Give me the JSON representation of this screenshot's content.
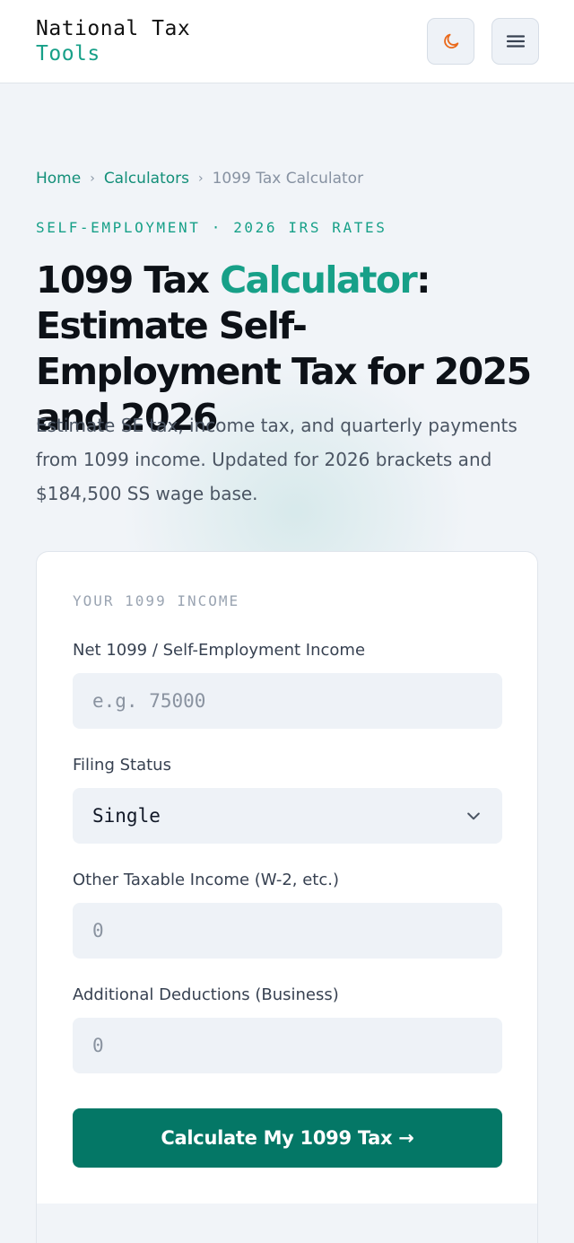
{
  "header": {
    "logo_line1": "National Tax",
    "logo_line2": "Tools",
    "theme_toggle_icon": "moon-icon",
    "menu_icon": "hamburger-menu-icon"
  },
  "breadcrumb": {
    "items": [
      "Home",
      "Calculators"
    ],
    "current": "1099 Tax Calculator",
    "separator": "›"
  },
  "hero": {
    "eyebrow": "SELF-EMPLOYMENT · 2026 IRS RATES",
    "title_part1": "1099 Tax ",
    "title_accent": "Calculator",
    "title_part2": ": Estimate Self-Employment Tax for 2025 and 2026",
    "subtitle": "Estimate SE tax, income tax, and quarterly payments from 1099 income. Updated for 2026 brackets and $184,500 SS wage base."
  },
  "form": {
    "section_label": "YOUR 1099 INCOME",
    "fields": [
      {
        "label": "Net 1099 / Self-Employment Income",
        "placeholder": "e.g. 75000",
        "value": ""
      },
      {
        "label": "Filing Status",
        "selected": "Single"
      },
      {
        "label": "Other Taxable Income (W-2, etc.)",
        "placeholder": "0",
        "value": ""
      },
      {
        "label": "Additional Deductions (Business)",
        "placeholder": "0",
        "value": ""
      }
    ],
    "submit_label": "Calculate My 1099 Tax →"
  },
  "colors": {
    "accent": "#17a088",
    "button": "#047766",
    "moon_icon": "#ea6a1c"
  }
}
